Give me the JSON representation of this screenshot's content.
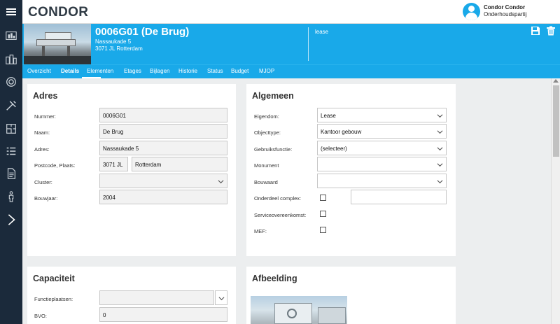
{
  "app": {
    "logo": "CONDOR"
  },
  "user": {
    "name": "Condor Condor",
    "role": "Onderhoudspartij"
  },
  "sidebar": {
    "items": [
      {
        "icon": "building-dashboard-icon"
      },
      {
        "icon": "city-icon"
      },
      {
        "icon": "lifebuoy-icon"
      },
      {
        "icon": "tools-icon"
      },
      {
        "icon": "floorplan-icon"
      },
      {
        "icon": "checklist-icon"
      },
      {
        "icon": "document-icon"
      },
      {
        "icon": "person-icon"
      },
      {
        "icon": "chevron-right-icon"
      }
    ]
  },
  "object": {
    "title": "0006G01 (De Brug)",
    "address_line1": "Nassaukade 5",
    "address_line2": "3071 JL Rotterdam",
    "type": "lease",
    "accent_color": "#19a9e9"
  },
  "tabs": [
    {
      "label": "Overzicht",
      "active": false
    },
    {
      "label": "Details",
      "active": true
    },
    {
      "label": "Elementen",
      "active": false
    },
    {
      "label": "Etages",
      "active": false
    },
    {
      "label": "Bijlagen",
      "active": false
    },
    {
      "label": "Historie",
      "active": false
    },
    {
      "label": "Status",
      "active": false
    },
    {
      "label": "Budget",
      "active": false
    },
    {
      "label": "MJOP",
      "active": false
    }
  ],
  "adres": {
    "title": "Adres",
    "nummer_label": "Nummer:",
    "nummer_value": "0006G01",
    "naam_label": "Naam:",
    "naam_value": "De Brug",
    "adres_label": "Adres:",
    "adres_value": "Nassaukade 5",
    "postcode_label": "Postcode, Plaats:",
    "postcode_value": "3071 JL",
    "plaats_value": "Rotterdam",
    "cluster_label": "Cluster:",
    "cluster_value": "",
    "bouwjaar_label": "Bouwjaar:",
    "bouwjaar_value": "2004"
  },
  "algemeen": {
    "title": "Algemeen",
    "eigendom_label": "Eigendom:",
    "eigendom_value": "Lease",
    "objecttype_label": "Objecttype:",
    "objecttype_value": "Kantoor gebouw",
    "gebruiksfunctie_label": "Gebruiksfunctie:",
    "gebruiksfunctie_value": "(selecteer)",
    "monument_label": "Monument",
    "monument_value": "",
    "bouwaard_label": "Bouwaard",
    "bouwaard_value": "",
    "onderdeel_label": "Onderdeel complex:",
    "onderdeel_checked": false,
    "onderdeel_value": "",
    "service_label": "Serviceovereenkomst:",
    "service_checked": false,
    "mef_label": "MEF:",
    "mef_checked": false
  },
  "capaciteit": {
    "title": "Capaciteit",
    "functieplaatsen_label": "Functieplaatsen:",
    "functieplaatsen_value": "",
    "bvo_label": "BVO:",
    "bvo_value": "0"
  },
  "afbeelding": {
    "title": "Afbeelding"
  }
}
